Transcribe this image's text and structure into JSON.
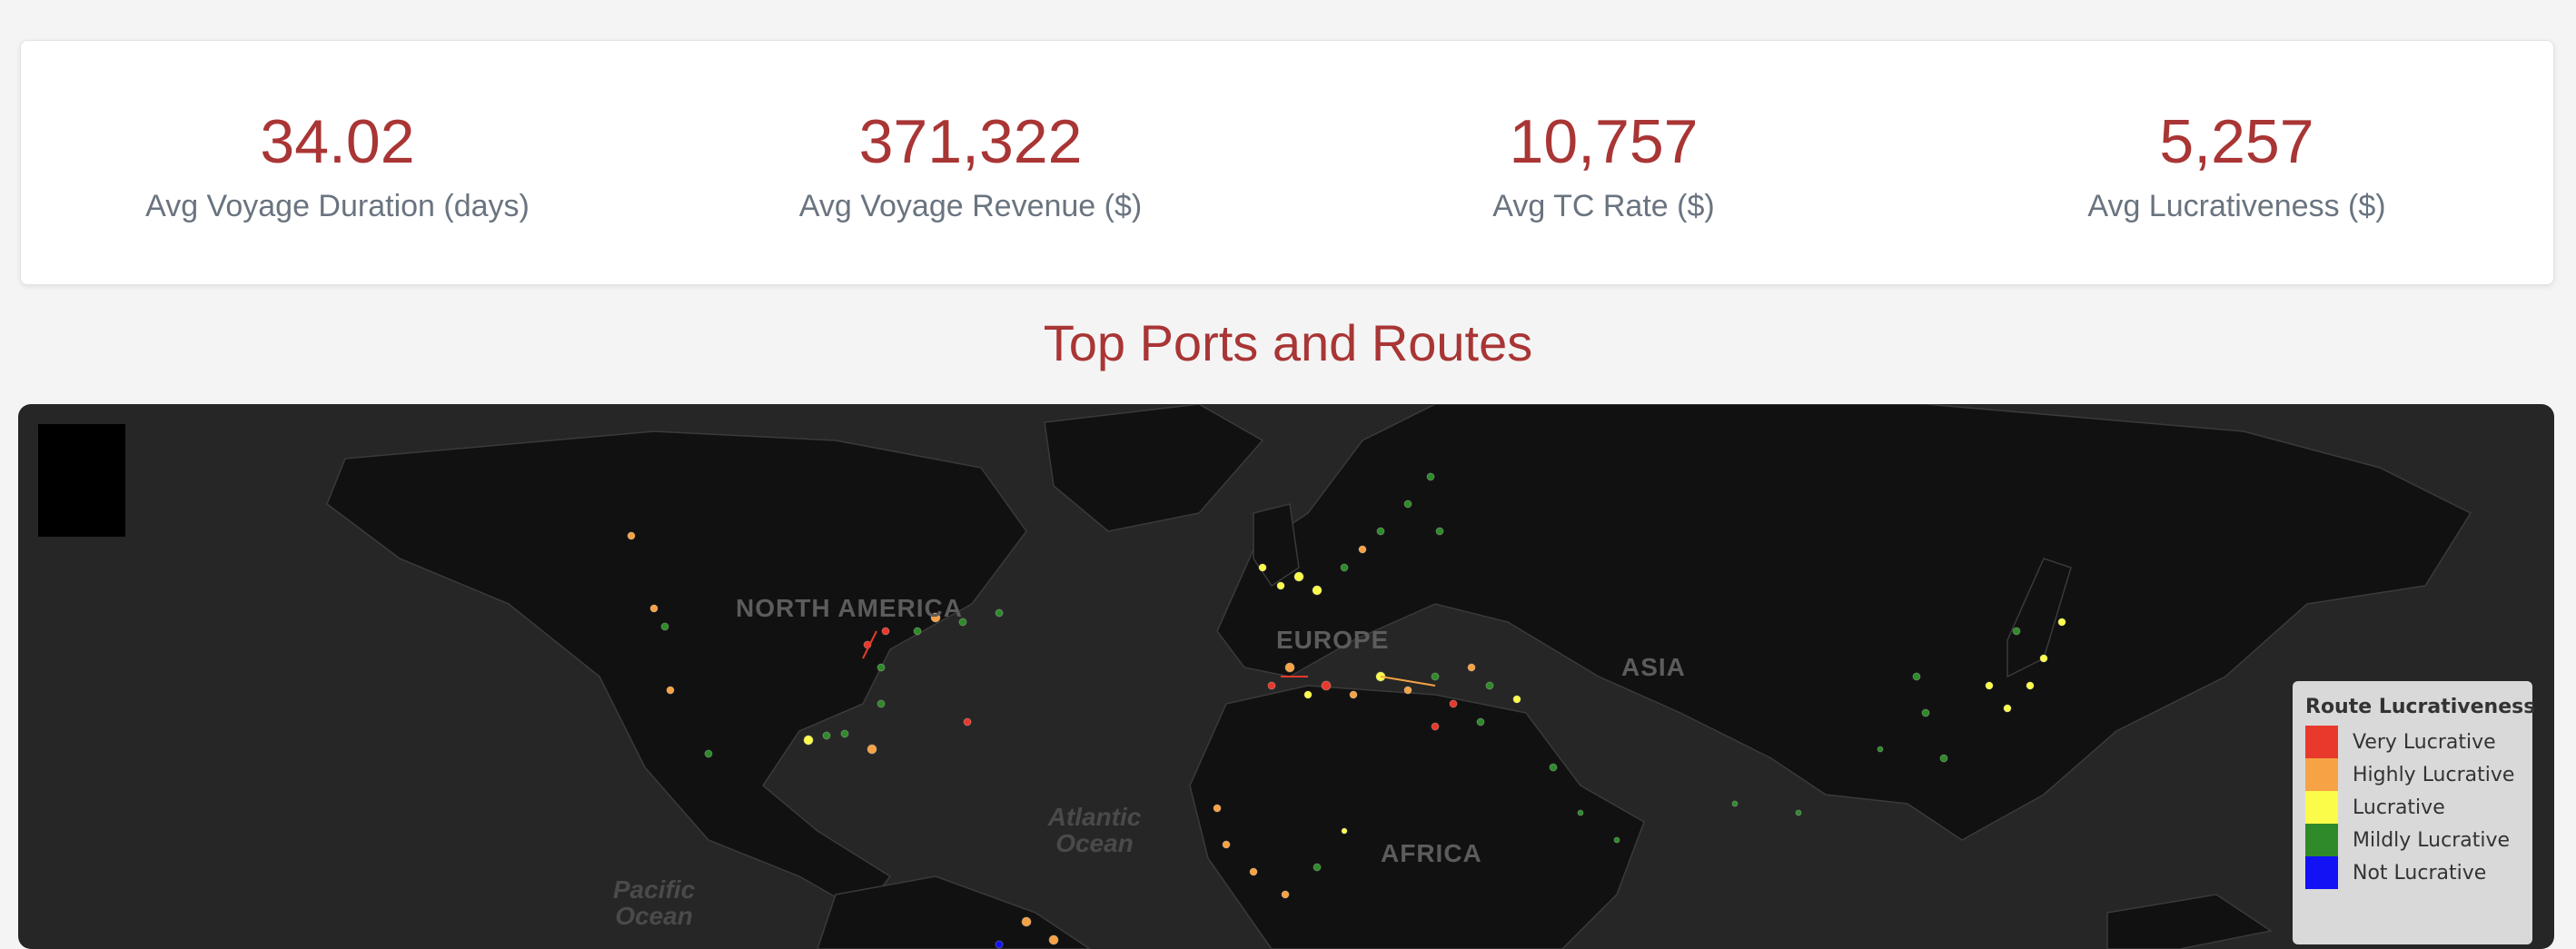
{
  "stats": [
    {
      "value": "34.02",
      "label": "Avg Voyage Duration (days)"
    },
    {
      "value": "371,322",
      "label": "Avg Voyage Revenue ($)"
    },
    {
      "value": "10,757",
      "label": "Avg TC Rate ($)"
    },
    {
      "value": "5,257",
      "label": "Avg Lucrativeness ($)"
    }
  ],
  "section_title": "Top Ports and Routes",
  "map": {
    "continent_labels": {
      "north_america": "NORTH AMERICA",
      "europe": "EUROPE",
      "asia": "ASIA",
      "africa": "AFRICA"
    },
    "ocean_labels": {
      "atlantic": "Atlantic Ocean",
      "pacific": "Pacific Ocean"
    },
    "background_color": "#262626",
    "land_color": "#111111"
  },
  "legend": {
    "title": "Route Lucrativeness",
    "items": [
      {
        "label": "Very Lucrative",
        "color": "#e8392c"
      },
      {
        "label": "Highly Lucrative",
        "color": "#f5a345"
      },
      {
        "label": "Lucrative",
        "color": "#fbfb4a"
      },
      {
        "label": "Mildly Lucrative",
        "color": "#2f8a2a"
      },
      {
        "label": "Not Lucrative",
        "color": "#1212f5"
      }
    ]
  }
}
